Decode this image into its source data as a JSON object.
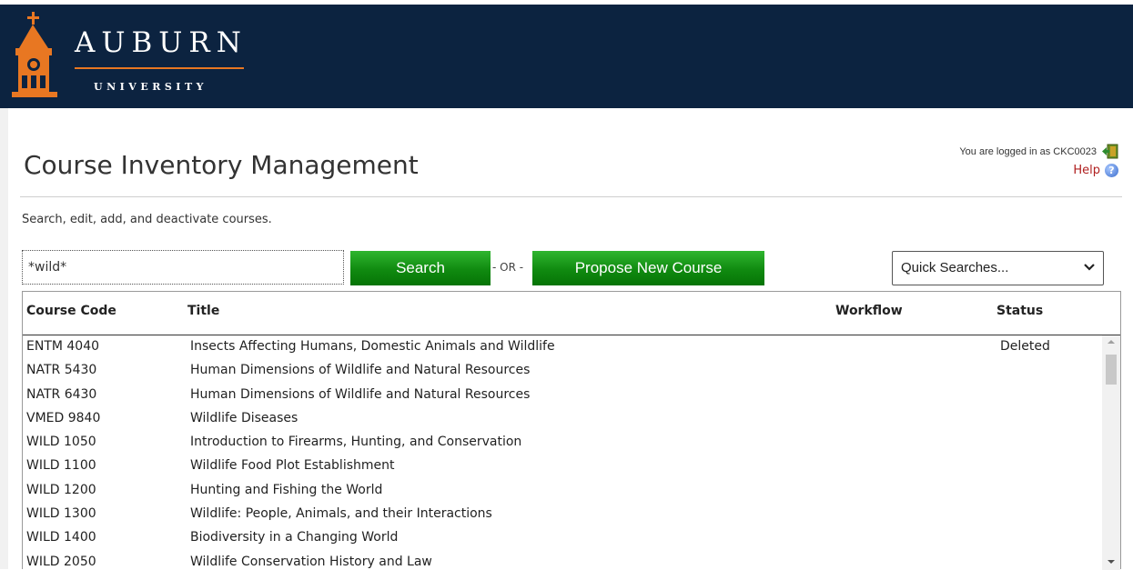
{
  "header": {
    "logo_word": "AUBURN",
    "logo_sub": "UNIVERSITY"
  },
  "page": {
    "title": "Course Inventory Management",
    "subtitle": "Search, edit, add, and deactivate courses.",
    "login_info": "You are logged in as CKC0023",
    "help_label": "Help"
  },
  "search": {
    "value": "*wild*",
    "search_label": "Search",
    "or_label": "- OR -",
    "propose_label": "Propose New Course",
    "quick_searches_selected": "Quick Searches..."
  },
  "table": {
    "columns": {
      "code": "Course Code",
      "title": "Title",
      "workflow": "Workflow",
      "status": "Status"
    },
    "rows": [
      {
        "code": "ENTM 4040",
        "title": "Insects Affecting Humans, Domestic Animals and Wildlife",
        "workflow": "",
        "status": "Deleted"
      },
      {
        "code": "NATR 5430",
        "title": "Human Dimensions of Wildlife and Natural Resources",
        "workflow": "",
        "status": ""
      },
      {
        "code": "NATR 6430",
        "title": "Human Dimensions of Wildlife and Natural Resources",
        "workflow": "",
        "status": ""
      },
      {
        "code": "VMED 9840",
        "title": "Wildlife Diseases",
        "workflow": "",
        "status": ""
      },
      {
        "code": "WILD 1050",
        "title": "Introduction to Firearms, Hunting, and Conservation",
        "workflow": "",
        "status": ""
      },
      {
        "code": "WILD 1100",
        "title": "Wildlife Food Plot Establishment",
        "workflow": "",
        "status": ""
      },
      {
        "code": "WILD 1200",
        "title": "Hunting and Fishing the World",
        "workflow": "",
        "status": ""
      },
      {
        "code": "WILD 1300",
        "title": "Wildlife: People, Animals, and their Interactions",
        "workflow": "",
        "status": ""
      },
      {
        "code": "WILD 1400",
        "title": "Biodiversity in a Changing World",
        "workflow": "",
        "status": ""
      },
      {
        "code": "WILD 2050",
        "title": "Wildlife Conservation History and Law",
        "workflow": "",
        "status": ""
      }
    ]
  },
  "colors": {
    "header_bg": "#0c2340",
    "accent_orange": "#e87722",
    "button_green": "#108a10",
    "help_red": "#b02020"
  },
  "icons": [
    "auburn-tower-logo-icon",
    "logout-door-icon",
    "help-question-icon",
    "chevron-down-icon",
    "scroll-up-arrow-icon",
    "scroll-down-arrow-icon"
  ]
}
